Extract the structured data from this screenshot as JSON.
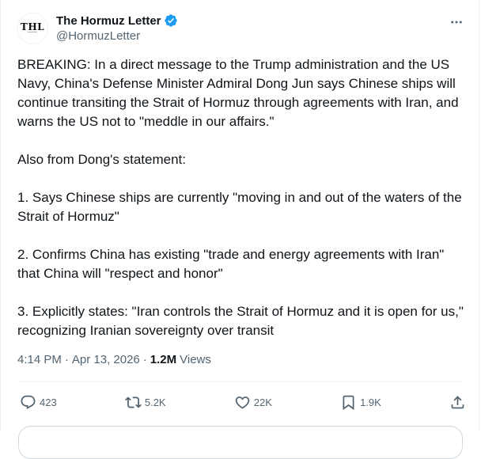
{
  "author": {
    "display_name": "The Hormuz Letter",
    "handle": "@HormuzLetter",
    "avatar_text": "THL",
    "avatar_icon": "thl-logo",
    "verified": true,
    "verified_color": "#1d9bf0"
  },
  "tweet": {
    "paragraphs": [
      "BREAKING: In a direct message to the Trump administration and the US Navy, China's Defense Minister Admiral Dong Jun says Chinese ships will continue transiting the Strait of Hormuz through agreements with Iran, and warns the US not to \"meddle in our affairs.\"",
      "Also from Dong's statement:",
      "1. Says Chinese ships are currently \"moving in and out of the waters of the Strait of Hormuz\"",
      "2. Confirms China has existing \"trade and energy agreements with Iran\" that China will \"respect and honor\"",
      "3. Explicitly states: \"Iran controls the Strait of Hormuz and it is open for us,\" recognizing Iranian sovereignty over transit"
    ],
    "time": "4:14 PM",
    "date": "Apr 13, 2026",
    "separator": "·",
    "views_count": "1.2M",
    "views_label": "Views"
  },
  "actions": {
    "replies": "423",
    "reposts": "5.2K",
    "likes": "22K",
    "bookmarks": "1.9K"
  },
  "colors": {
    "text": "#0f1419",
    "secondary": "#536471",
    "border": "#eff3f4"
  }
}
